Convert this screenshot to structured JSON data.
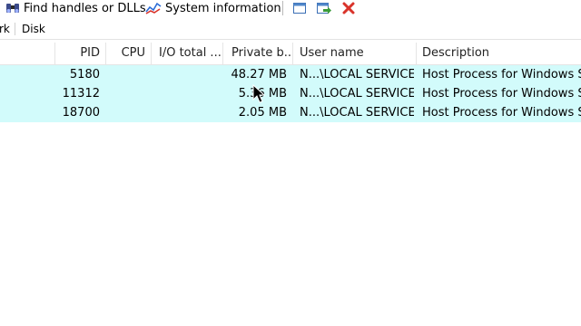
{
  "toolbar": {
    "find_handles_label": "Find handles or DLLs",
    "system_info_label": "System information"
  },
  "tabs": [
    "rk",
    "Disk"
  ],
  "columns": {
    "pid": "PID",
    "cpu": "CPU",
    "io_total": "I/O total ...",
    "private_bytes": "Private b...",
    "user_name": "User name",
    "description": "Description"
  },
  "rows": [
    {
      "pid": "5180",
      "cpu": "",
      "io": "",
      "private": "48.27 MB",
      "user": "N...\\LOCAL SERVICE",
      "desc": "Host Process for Windows Ser"
    },
    {
      "pid": "11312",
      "cpu": "",
      "io": "",
      "private": "5.36 MB",
      "user": "N...\\LOCAL SERVICE",
      "desc": "Host Process for Windows Ser"
    },
    {
      "pid": "18700",
      "cpu": "",
      "io": "",
      "private": "2.05 MB",
      "user": "N...\\LOCAL SERVICE",
      "desc": "Host Process for Windows Ser"
    }
  ],
  "colors": {
    "row_highlight": "#d2fbfb",
    "close_red": "#d9332a",
    "accent_green": "#3a9b3a"
  }
}
